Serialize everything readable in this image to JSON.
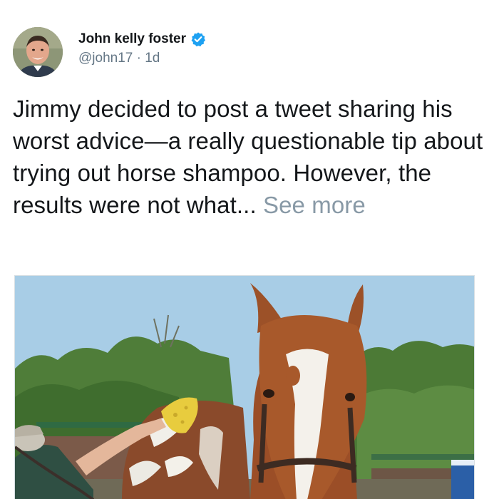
{
  "author": {
    "display_name": "John kelly foster",
    "handle": "@john17",
    "separator": " · ",
    "timestamp": "1d",
    "verified": true
  },
  "tweet": {
    "text": "Jimmy decided to post a tweet sharing his worst advice—a really questionable tip about trying out horse shampoo. However, the results were not what... ",
    "see_more_label": "See more"
  },
  "colors": {
    "verified_badge": "#1da1f2",
    "text_primary": "#14171a",
    "text_secondary": "#657786",
    "see_more": "#8899a6"
  },
  "media": {
    "icon": "photo-of-horse-being-washed"
  }
}
